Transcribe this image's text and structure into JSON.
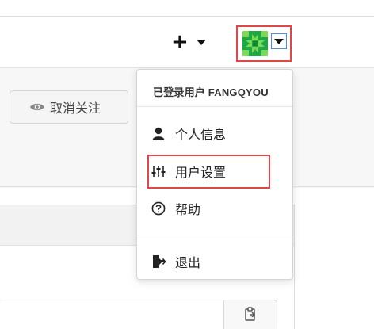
{
  "navbar": {
    "create_label": "+",
    "avatar_icon": "identicon-avatar",
    "avatar_color": "#1ca845"
  },
  "repo": {
    "unwatch_label": "取消关注"
  },
  "dropdown": {
    "header": "已登录用户 FANGQYOU",
    "items": [
      {
        "label": "个人信息",
        "icon": "user-icon"
      },
      {
        "label": "用户设置",
        "icon": "sliders-icon"
      },
      {
        "label": "帮助",
        "icon": "help-circle-icon"
      },
      {
        "label": "退出",
        "icon": "sign-out-icon"
      }
    ]
  },
  "colors": {
    "highlight": "#e04848",
    "focus_border": "#4a90e2"
  }
}
